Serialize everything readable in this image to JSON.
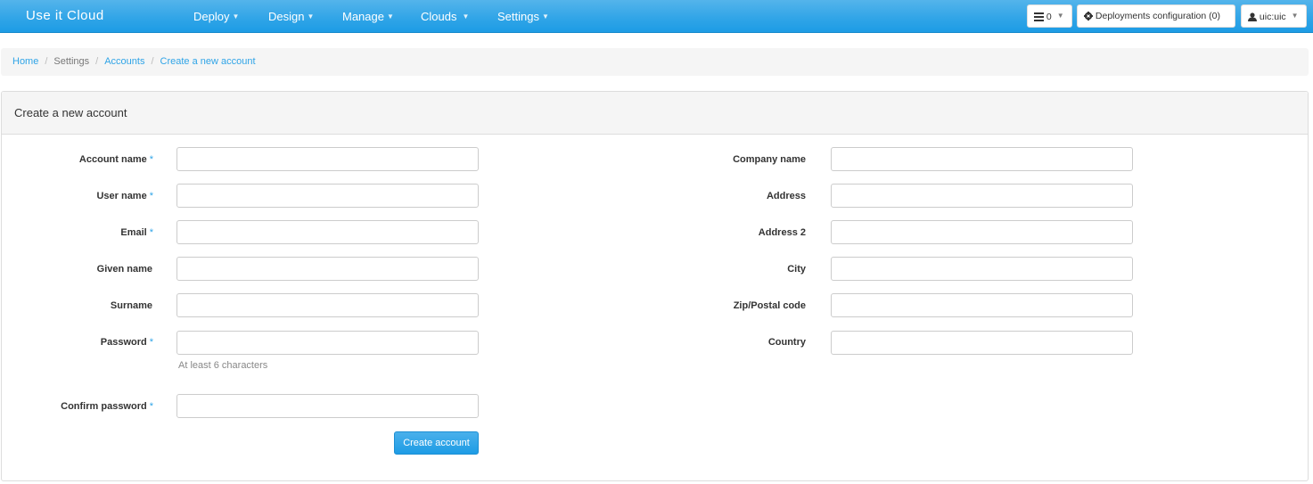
{
  "navbar": {
    "brand": "Use it Cloud",
    "menu": [
      {
        "label": "Deploy"
      },
      {
        "label": "Design"
      },
      {
        "label": "Manage"
      },
      {
        "label": "Clouds"
      },
      {
        "label": "Settings"
      }
    ],
    "tasks_count": "0",
    "deployments_label": "Deployments configuration (0)",
    "user_label": "uic:uic"
  },
  "breadcrumb": {
    "home": "Home",
    "settings": "Settings",
    "accounts": "Accounts",
    "current": "Create a new account",
    "separator": "/"
  },
  "panel": {
    "title": "Create a new account"
  },
  "form": {
    "required_marker": "*",
    "left": [
      {
        "label": "Account name",
        "required": true,
        "value": ""
      },
      {
        "label": "User name",
        "required": true,
        "value": ""
      },
      {
        "label": "Email",
        "required": true,
        "value": ""
      },
      {
        "label": "Given name",
        "required": false,
        "value": ""
      },
      {
        "label": "Surname",
        "required": false,
        "value": ""
      },
      {
        "label": "Password",
        "required": true,
        "value": ""
      },
      {
        "label": "Confirm password",
        "required": true,
        "value": ""
      }
    ],
    "password_help": "At least 6 characters",
    "right": [
      {
        "label": "Company name",
        "value": ""
      },
      {
        "label": "Address",
        "value": ""
      },
      {
        "label": "Address 2",
        "value": ""
      },
      {
        "label": "City",
        "value": ""
      },
      {
        "label": "Zip/Postal code",
        "value": ""
      },
      {
        "label": "Country",
        "value": ""
      }
    ],
    "submit_label": "Create account"
  },
  "colors": {
    "accent": "#2fa4e7",
    "navbar": "#2fa4e7"
  }
}
